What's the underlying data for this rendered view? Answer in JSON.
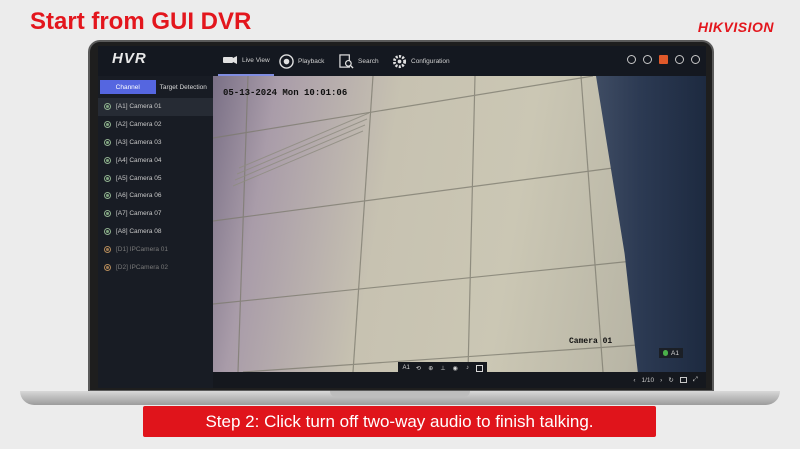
{
  "slide": {
    "title": "Start from GUI DVR",
    "brand": "HIKVISION",
    "caption": "Step 2:  Click turn off  two-way audio to finish talking.",
    "title_color": "#e3161d",
    "caption_bg": "#e0141b"
  },
  "app": {
    "logo": "HVR",
    "menu": [
      {
        "label": "Live View",
        "icon": "camera-icon",
        "active": true
      },
      {
        "label": "Playback",
        "icon": "playback-icon"
      },
      {
        "label": "Search",
        "icon": "search-icon"
      },
      {
        "label": "Configuration",
        "icon": "gear-icon"
      }
    ],
    "top_icons": [
      "info-icon",
      "record-icon",
      "alarm-flag-icon",
      "download-icon",
      "power-icon"
    ],
    "accent": "#5566e0"
  },
  "sidebar": {
    "tabs": [
      "Channel",
      "Target Detection"
    ],
    "cameras": [
      "[A1] Camera 01",
      "[A2] Camera 02",
      "[A3] Camera 03",
      "[A4] Camera 04",
      "[A5] Camera 05",
      "[A6] Camera 06",
      "[A7] Camera 07",
      "[A8] Camera 08",
      "[D1] IPCamera 01",
      "[D2] IPCamera 02"
    ],
    "selected_index": 0
  },
  "video": {
    "osd_time": "05-13-2024 Mon 10:01:06",
    "osd_camera": "Camera 01",
    "channel_badge": "A1"
  },
  "toolbar": {
    "channel": "A1",
    "icons": [
      "instant-playback-icon",
      "zoom-icon",
      "capture-icon",
      "audio-icon",
      "two-way-audio-icon",
      "window-icon"
    ]
  },
  "statusbar": {
    "page": "1/10"
  }
}
